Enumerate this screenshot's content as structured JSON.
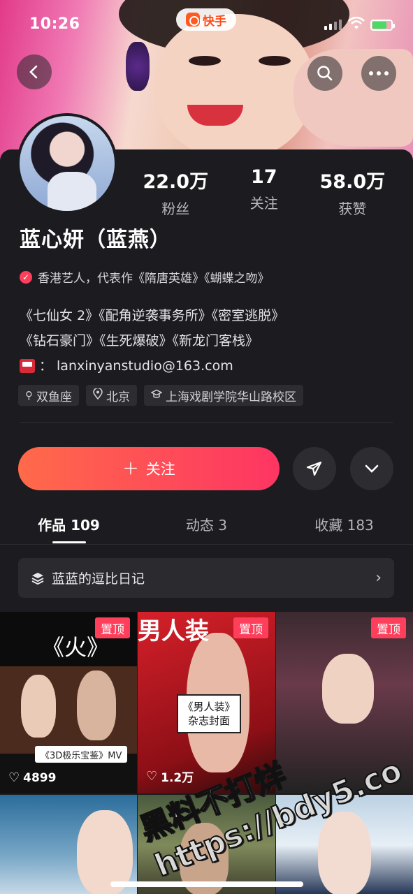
{
  "status_bar": {
    "time": "10:26",
    "app_name": "快手"
  },
  "profile": {
    "name": "蓝心妍（蓝燕）",
    "verification": "香港艺人，代表作《隋唐英雄》《蝴蝶之吻》",
    "stats": [
      {
        "value": "22.0万",
        "label": "粉丝"
      },
      {
        "value": "17",
        "label": "关注"
      },
      {
        "value": "58.0万",
        "label": "获赞"
      }
    ],
    "bio_lines": [
      "《七仙女 2》《配角逆袭事务所》《密室逃脱》",
      "《钻石豪门》《生死爆破》《新龙门客栈》"
    ],
    "email_prefix": "：",
    "email": "lanxinyanstudio@163.com",
    "tags": [
      {
        "icon": "zodiac-icon",
        "label": "双鱼座"
      },
      {
        "icon": "location-icon",
        "label": "北京"
      },
      {
        "icon": "school-icon",
        "label": "上海戏剧学院华山路校区"
      }
    ]
  },
  "actions": {
    "follow_label": "关注",
    "follow_plus": "+"
  },
  "tabs": [
    {
      "label": "作品 109",
      "active": true
    },
    {
      "label": "动态 3",
      "active": false
    },
    {
      "label": "收藏 183",
      "active": false
    }
  ],
  "collection": {
    "label": "蓝蓝的逗比日记"
  },
  "grid": [
    {
      "pin": "置顶",
      "likes": "4899",
      "title": "《火》",
      "caption": "《3D极乐宝鉴》MV"
    },
    {
      "pin": "置顶",
      "likes": "1.2万",
      "brand": "男人装",
      "caption": "《男人装》杂志封面"
    },
    {
      "pin": "置顶",
      "likes": ""
    },
    {
      "pin": "",
      "likes": ""
    },
    {
      "pin": "",
      "likes": ""
    },
    {
      "pin": "",
      "likes": ""
    }
  ],
  "watermark": {
    "line1": "黑料不打烊",
    "line2": "https://bdy5.co"
  },
  "colors": {
    "accent": "#fe3f5c",
    "panel": "#1c1c20",
    "follow_gradient_start": "#ff6a4a",
    "follow_gradient_end": "#fe3563"
  }
}
